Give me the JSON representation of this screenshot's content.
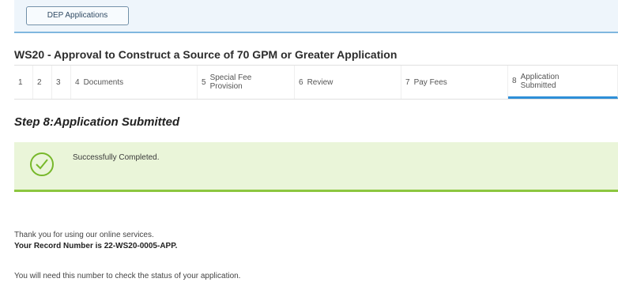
{
  "header": {
    "dep_button_label": "DEP Applications"
  },
  "application": {
    "title": "WS20 - Approval to Construct a Source of 70 GPM or Greater Application"
  },
  "steps": [
    {
      "num": "1",
      "label": ""
    },
    {
      "num": "2",
      "label": ""
    },
    {
      "num": "3",
      "label": ""
    },
    {
      "num": "4",
      "label": "Documents"
    },
    {
      "num": "5",
      "label": "Special Fee Provision"
    },
    {
      "num": "6",
      "label": "Review"
    },
    {
      "num": "7",
      "label": "Pay Fees"
    },
    {
      "num": "8",
      "label": "Application Submitted"
    }
  ],
  "step_heading": "Step 8:Application Submitted",
  "status": {
    "message": "Successfully Completed.",
    "icon": "check-circle-icon",
    "color": "#8cc63f"
  },
  "confirmation": {
    "thanks": "Thank you for using our online services.",
    "record_line": "Your Record Number is 22-WS20-0005-APP.",
    "note": "You will need this number to check the status of your application."
  }
}
